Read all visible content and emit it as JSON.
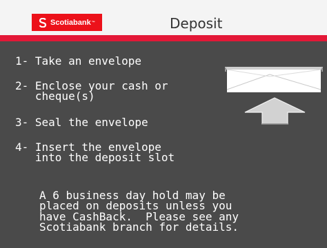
{
  "header": {
    "brand": "Scotiabank",
    "title": "Deposit"
  },
  "steps": [
    {
      "text": "1- Take an envelope"
    },
    {
      "text": "2- Enclose your cash or\n   cheque(s)"
    },
    {
      "text": "3- Seal the envelope"
    },
    {
      "text": "4- Insert the envelope\n   into the deposit slot"
    }
  ],
  "notice": {
    "text": "A 6 business day hold may be\nplaced on deposits unless you\nhave CashBack.  Please see any\nScotiabank branch for details."
  },
  "icons": {
    "logo": "scotiabank-s-logo-icon",
    "envelope": "envelope-insert-arrow-icon"
  },
  "colors": {
    "brand_red": "#ec111a",
    "background": "#4a4a4a",
    "header_bg": "#f4f4f4"
  }
}
